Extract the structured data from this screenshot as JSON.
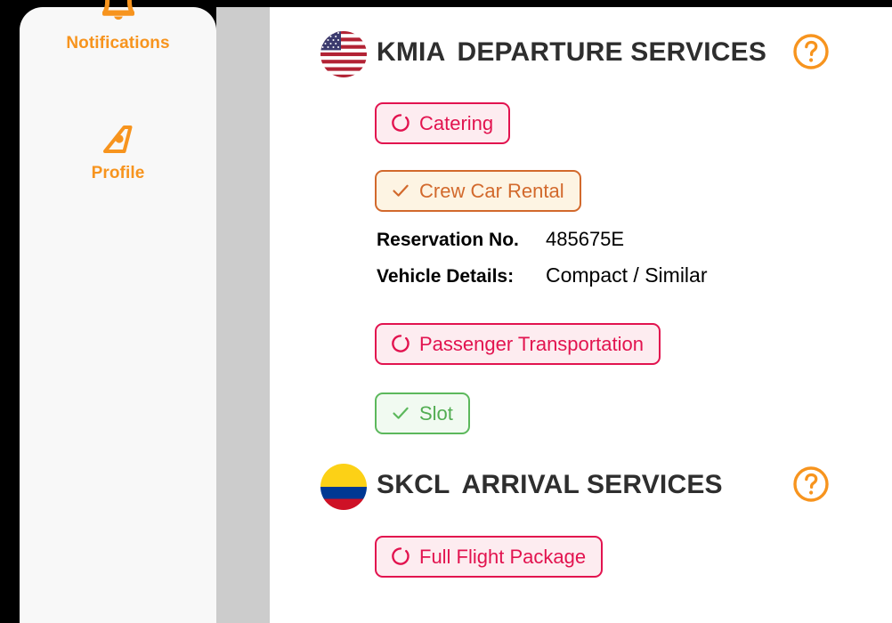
{
  "sidebar": {
    "items": [
      {
        "label": "Notifications",
        "icon": "bell-icon"
      },
      {
        "label": "Profile",
        "icon": "airline-tail-icon"
      }
    ],
    "accent_color": "#f7941e"
  },
  "sections": [
    {
      "id": "departure",
      "flag": "us-flag-icon",
      "airport_code": "KMIA",
      "title": "DEPARTURE SERVICES",
      "help_icon": "help-circle-icon",
      "services": [
        {
          "label": "Catering",
          "status": "pending",
          "icon": "pending-circle-icon"
        },
        {
          "label": "Crew Car Rental",
          "status": "confirmed-orange",
          "icon": "check-icon"
        },
        {
          "label": "Passenger Transportation",
          "status": "pending",
          "icon": "pending-circle-icon"
        },
        {
          "label": "Slot",
          "status": "confirmed-green",
          "icon": "check-icon"
        }
      ],
      "details": [
        {
          "key": "Reservation No.",
          "value": "485675E"
        },
        {
          "key": "Vehicle Details:",
          "value": "Compact / Similar"
        }
      ]
    },
    {
      "id": "arrival",
      "flag": "colombia-flag-icon",
      "airport_code": "SKCL",
      "title": "ARRIVAL SERVICES",
      "help_icon": "help-circle-icon",
      "services": [
        {
          "label": "Full Flight Package",
          "status": "pending",
          "icon": "pending-circle-icon"
        }
      ],
      "details": []
    }
  ],
  "colors": {
    "accent_orange": "#f7941e",
    "pending_red": "#e2134f",
    "confirmed_orange": "#d2692c",
    "confirmed_green": "#5cb85c",
    "title_gray": "#2e2e2e",
    "sidebar_bg": "#f8f8f8",
    "scrollbar": "#cccccc"
  }
}
